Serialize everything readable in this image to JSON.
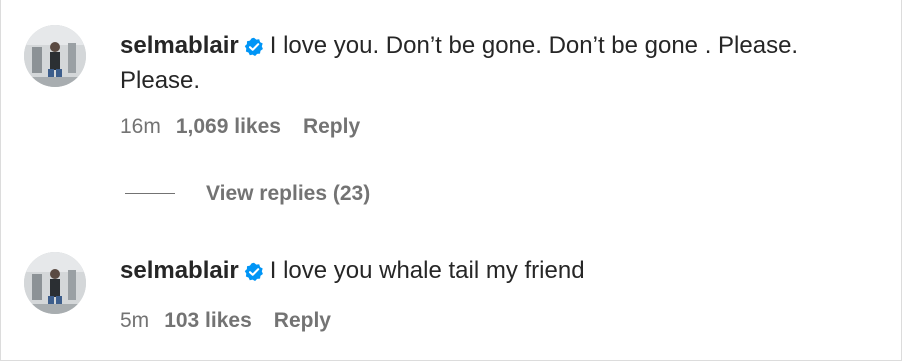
{
  "colors": {
    "text": "#262626",
    "secondary": "#737373",
    "verified_badge": "#0095f6",
    "background": "#ffffff"
  },
  "comments": [
    {
      "username": "selmablair",
      "verified_icon": "verified-badge-icon",
      "text": "I love you. Don’t be gone. Don’t be gone . Please. Please.",
      "time": "16m",
      "likes": "1,069 likes",
      "reply_label": "Reply"
    },
    {
      "username": "selmablair",
      "verified_icon": "verified-badge-icon",
      "text": "I love you whale tail my friend",
      "time": "5m",
      "likes": "103 likes",
      "reply_label": "Reply"
    }
  ],
  "view_replies_label": "View replies (23)"
}
